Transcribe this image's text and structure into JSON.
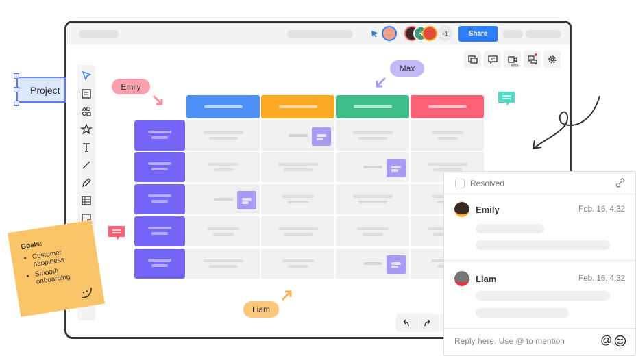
{
  "topbar": {
    "share_label": "Share",
    "avatar_initial": "R",
    "more_users": "+1"
  },
  "colors": {
    "accent": "#2d7ff9",
    "header_colors": [
      "#4a90f5",
      "#fca921",
      "#3cbd8a",
      "#fb6077"
    ],
    "row_header": "#7464f7",
    "sticky_small": "#a99af8"
  },
  "toolbar_right": [
    "frames-icon",
    "comment-icon",
    "video-icon",
    "chat-icon",
    "settings-icon"
  ],
  "video_badge": "BETA",
  "left_tools": [
    "select-icon",
    "template-icon",
    "shapes-icon",
    "star-icon",
    "text-icon",
    "line-icon",
    "pen-icon",
    "table-icon",
    "sticky-note-icon"
  ],
  "tags": {
    "emily": "Emily",
    "max": "Max",
    "liam": "Liam"
  },
  "project_label": "Project",
  "sticky": {
    "title": "Goals:",
    "items": [
      "Customer happiness",
      "Smooth onboarding"
    ]
  },
  "grid": {
    "rows": 5,
    "cols": 4,
    "notes": [
      [
        0,
        1
      ],
      [
        1,
        2
      ],
      [
        2,
        0
      ],
      [
        4,
        2
      ]
    ]
  },
  "comments": {
    "resolved_label": "Resolved",
    "resolved": false,
    "items": [
      {
        "author": "Emily",
        "time": "Feb. 16, 4:32"
      },
      {
        "author": "Liam",
        "time": "Feb. 16, 4:32"
      }
    ],
    "reply_placeholder": "Reply here. Use @ to mention"
  }
}
